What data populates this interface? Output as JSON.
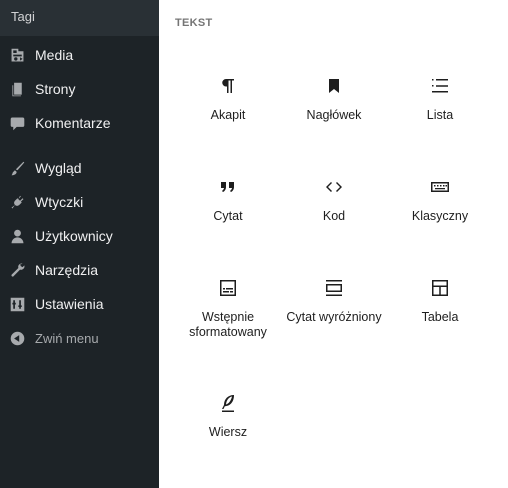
{
  "sidebar": {
    "top_item": "Tagi",
    "items": [
      {
        "label": "Media",
        "icon": "media-icon"
      },
      {
        "label": "Strony",
        "icon": "pages-icon"
      },
      {
        "label": "Komentarze",
        "icon": "comments-icon"
      },
      {
        "label": "Wygląd",
        "icon": "appearance-brush-icon"
      },
      {
        "label": "Wtyczki",
        "icon": "plugins-icon"
      },
      {
        "label": "Użytkownicy",
        "icon": "users-icon"
      },
      {
        "label": "Narzędzia",
        "icon": "tools-wrench-icon"
      },
      {
        "label": "Ustawienia",
        "icon": "settings-sliders-icon"
      }
    ],
    "collapse_label": "Zwiń menu"
  },
  "panel": {
    "section_title": "TEKST",
    "blocks": [
      {
        "label": "Akapit",
        "icon": "paragraph-icon"
      },
      {
        "label": "Nagłówek",
        "icon": "heading-bookmark-icon"
      },
      {
        "label": "Lista",
        "icon": "list-icon"
      },
      {
        "label": "Cytat",
        "icon": "quote-icon"
      },
      {
        "label": "Kod",
        "icon": "code-icon"
      },
      {
        "label": "Klasyczny",
        "icon": "keyboard-icon"
      },
      {
        "label": "Wstępnie sformatowany",
        "icon": "preformatted-icon"
      },
      {
        "label": "Cytat wyróżniony",
        "icon": "pullquote-icon"
      },
      {
        "label": "Tabela",
        "icon": "table-icon"
      },
      {
        "label": "Wiersz",
        "icon": "verse-feather-icon"
      }
    ]
  },
  "colors": {
    "sidebar_bg": "#1d2327",
    "sidebar_top_bg": "#2c3338",
    "sidebar_text": "#f0f0f1",
    "icon_gray": "#a7aaad"
  }
}
